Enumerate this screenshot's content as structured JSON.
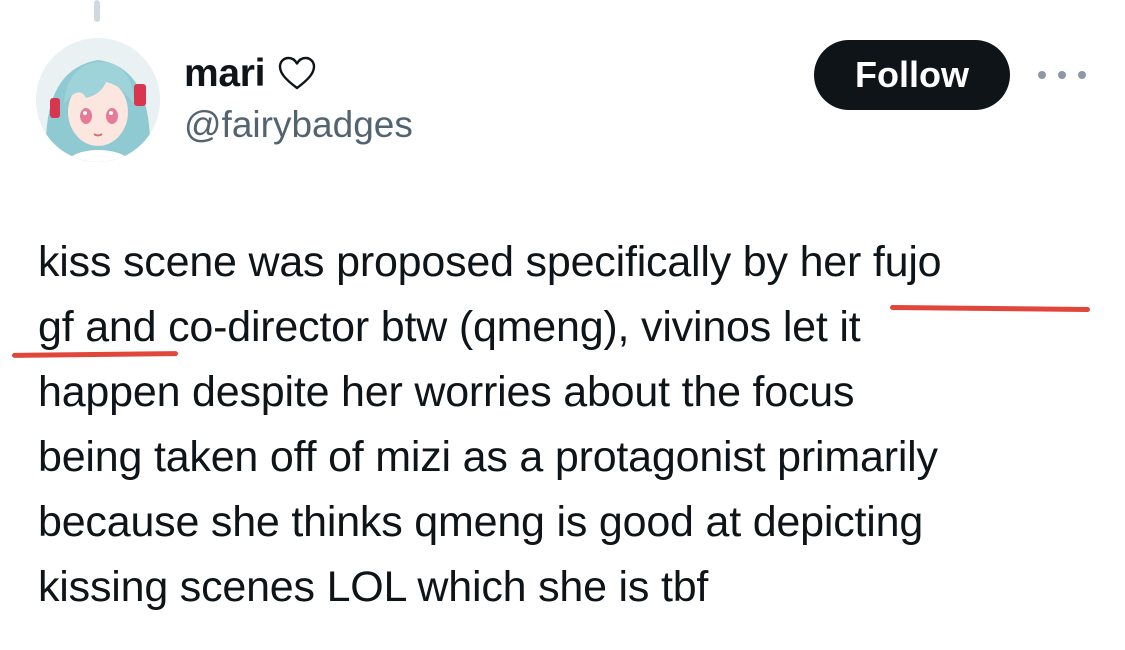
{
  "tweet": {
    "author": {
      "display_name": "mari",
      "badge_icon": "heart-outline-icon",
      "handle": "@fairybadges",
      "avatar_icon": "anime-avatar"
    },
    "follow_label": "Follow",
    "more_icon": "more-horizontal-icon",
    "text_lines": [
      "kiss scene was proposed specifically by her fujo",
      "gf and co-director btw (qmeng), vivinos let it",
      "happen despite her worries about the focus",
      "being taken off of mizi as a protagonist primarily",
      "because she thinks qmeng is good at depicting",
      "kissing scenes LOL which she is tbf"
    ],
    "annotations": {
      "underline_color": "#e0463a"
    }
  },
  "colors": {
    "text": "#0f1419",
    "secondary_text": "#536471",
    "follow_button_bg": "#0f1419",
    "follow_button_text": "#ffffff"
  }
}
